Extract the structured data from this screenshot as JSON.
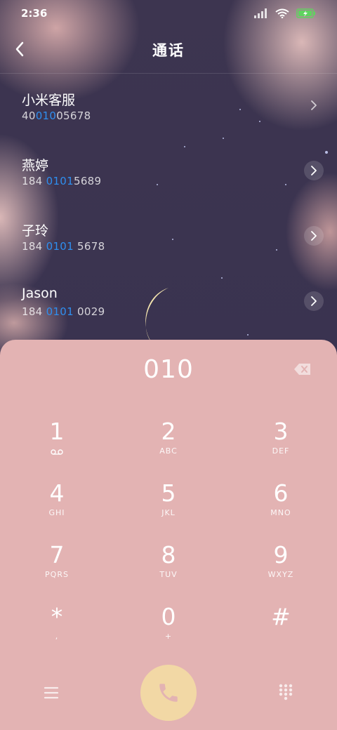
{
  "status_bar": {
    "time": "2:36",
    "signal_icon": "signal-icon",
    "wifi_icon": "wifi-icon",
    "battery_icon": "battery-charging-icon",
    "battery_color": "#5fd35f"
  },
  "header": {
    "title": "通话",
    "back_icon": "chevron-left-icon"
  },
  "contacts": [
    {
      "name": "小米客服",
      "number_pre": "40",
      "number_hl": "010",
      "number_post": "05678"
    },
    {
      "name": "燕婷",
      "number_pre": "184 ",
      "number_hl": "0101",
      "number_post": "5689"
    },
    {
      "name": "子玲",
      "number_pre": "184 ",
      "number_hl": "0101",
      "number_post": " 5678"
    },
    {
      "name": "Jason",
      "number_pre": "184 ",
      "number_hl": "0101",
      "number_post": " 0029"
    }
  ],
  "dialer": {
    "display": "010",
    "backspace_icon": "backspace-icon",
    "keys": [
      {
        "digit": "1",
        "letters": ""
      },
      {
        "digit": "2",
        "letters": "ABC"
      },
      {
        "digit": "3",
        "letters": "DEF"
      },
      {
        "digit": "4",
        "letters": "GHI"
      },
      {
        "digit": "5",
        "letters": "JKL"
      },
      {
        "digit": "6",
        "letters": "MNO"
      },
      {
        "digit": "7",
        "letters": "PQRS"
      },
      {
        "digit": "8",
        "letters": "TUV"
      },
      {
        "digit": "9",
        "letters": "WXYZ"
      },
      {
        "digit": "*",
        "letters": ","
      },
      {
        "digit": "0",
        "letters": "+"
      },
      {
        "digit": "#",
        "letters": ""
      }
    ],
    "menu_icon": "menu-icon",
    "call_icon": "phone-icon",
    "keypad_icon": "keypad-icon"
  },
  "colors": {
    "highlight": "#2f8ff0",
    "dialer_bg": "#e3b3b3",
    "call_button": "#f2d8a5",
    "call_icon": "#e3b3b3"
  }
}
